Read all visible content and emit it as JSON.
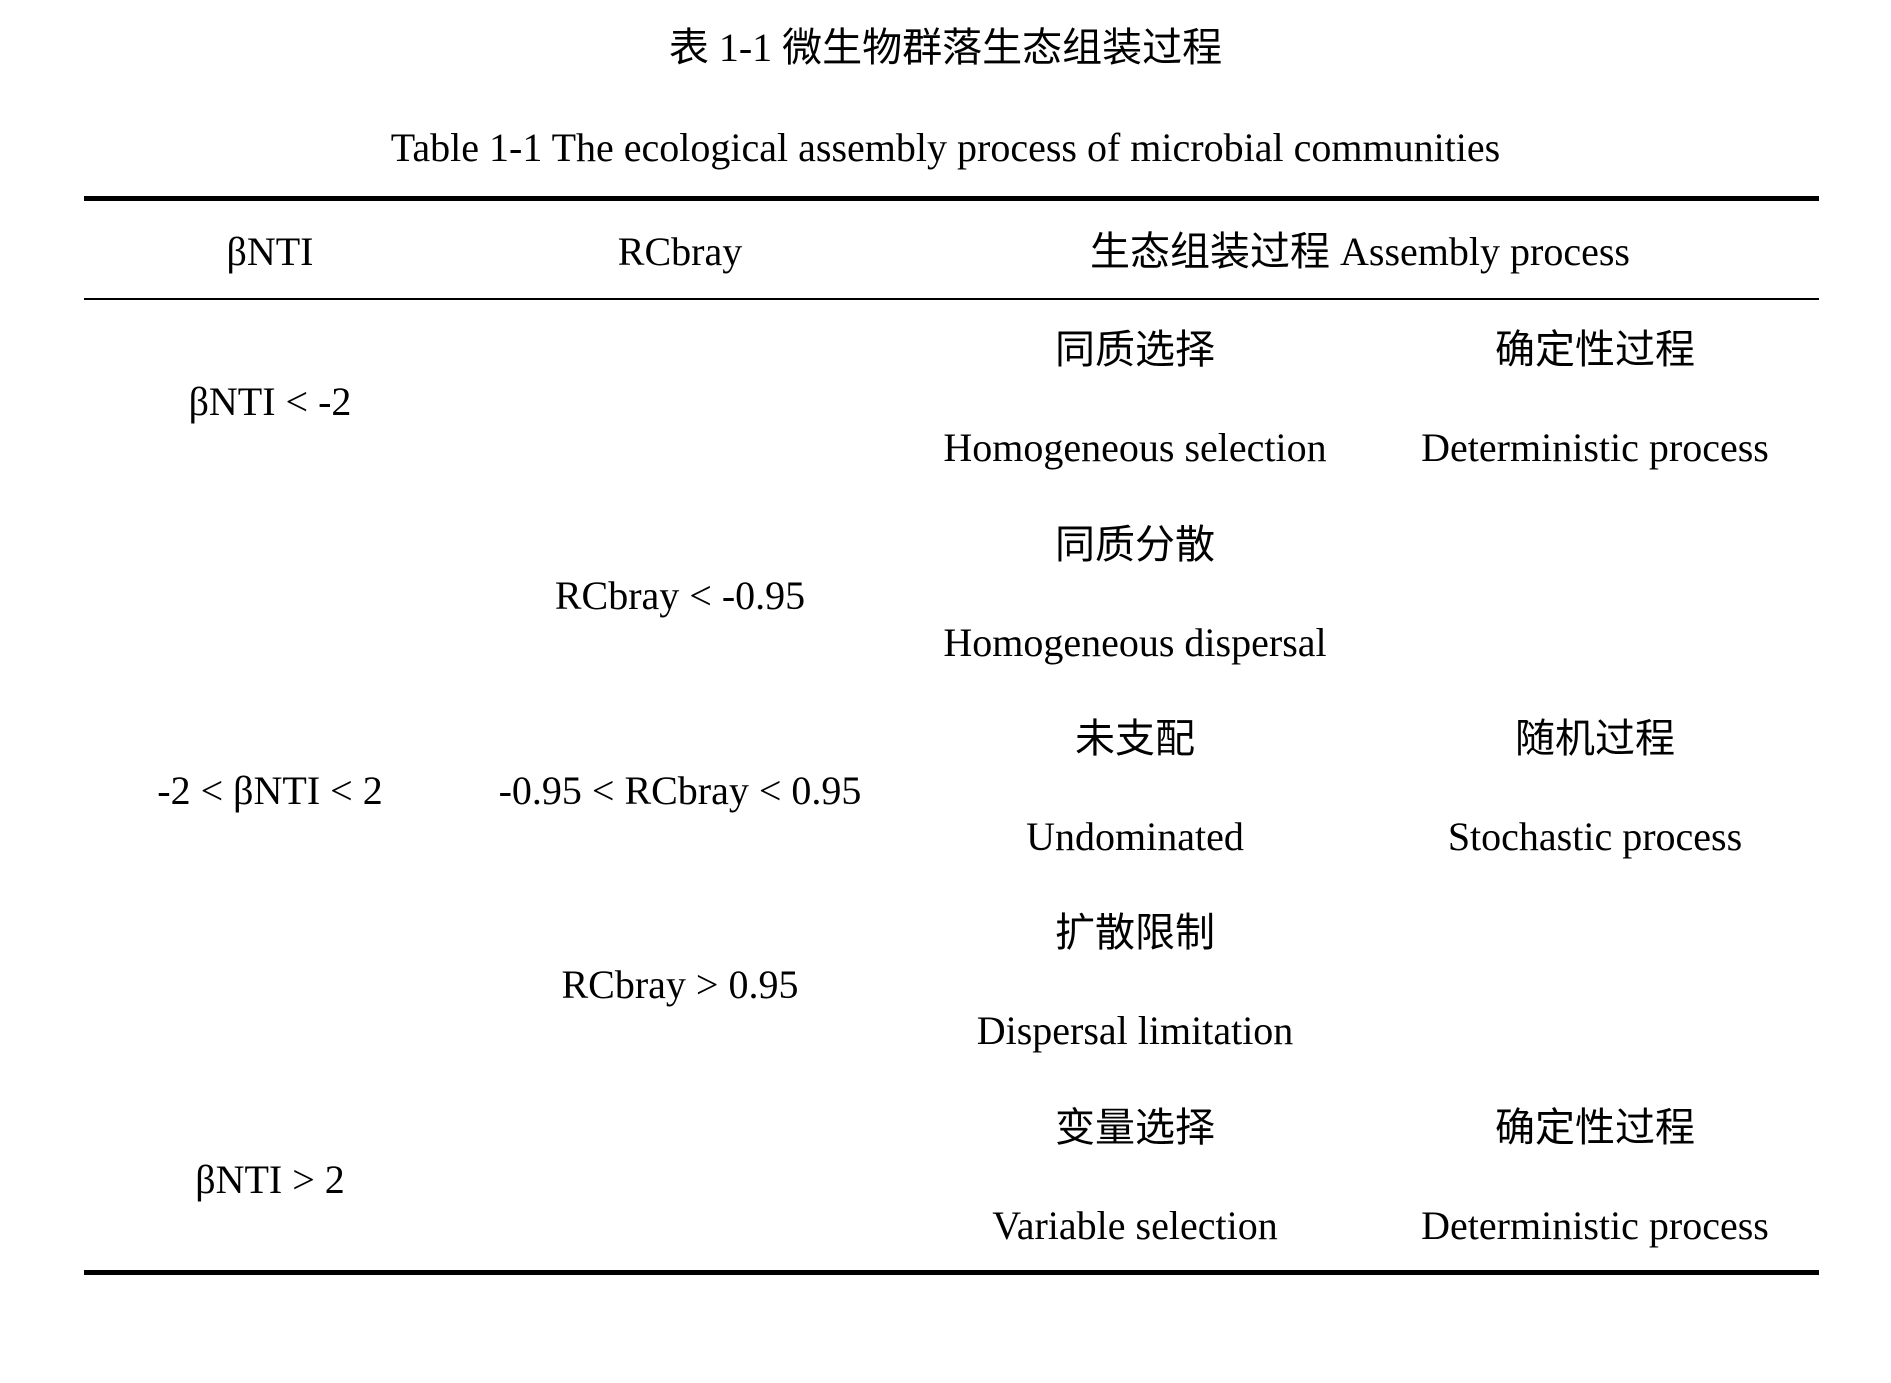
{
  "caption": {
    "cn": "表 1-1  微生物群落生态组装过程",
    "en": "Table 1-1 The ecological assembly process of microbial communities"
  },
  "table": {
    "headers": {
      "col1": "βNTI",
      "col2": "RCbray",
      "col3": "生态组装过程  Assembly process"
    },
    "rows": [
      {
        "bnti": "βNTI < -2",
        "process_cn": "同质选择",
        "process_en": "Homogeneous selection",
        "category_cn": "确定性过程",
        "category_en": "Deterministic process"
      },
      {
        "rcbray": "RCbray < -0.95",
        "process_cn": "同质分散",
        "process_en": "Homogeneous dispersal"
      },
      {
        "bnti": "-2 < βNTI < 2",
        "rcbray": "-0.95 < RCbray < 0.95",
        "process_cn": "未支配",
        "process_en": "Undominated",
        "category_cn": "随机过程",
        "category_en": "Stochastic process"
      },
      {
        "rcbray": "RCbray > 0.95",
        "process_cn": "扩散限制",
        "process_en": "Dispersal limitation"
      },
      {
        "bnti": "βNTI > 2",
        "process_cn": "变量选择",
        "process_en": "Variable selection",
        "category_cn": "确定性过程",
        "category_en": "Deterministic process"
      }
    ]
  }
}
